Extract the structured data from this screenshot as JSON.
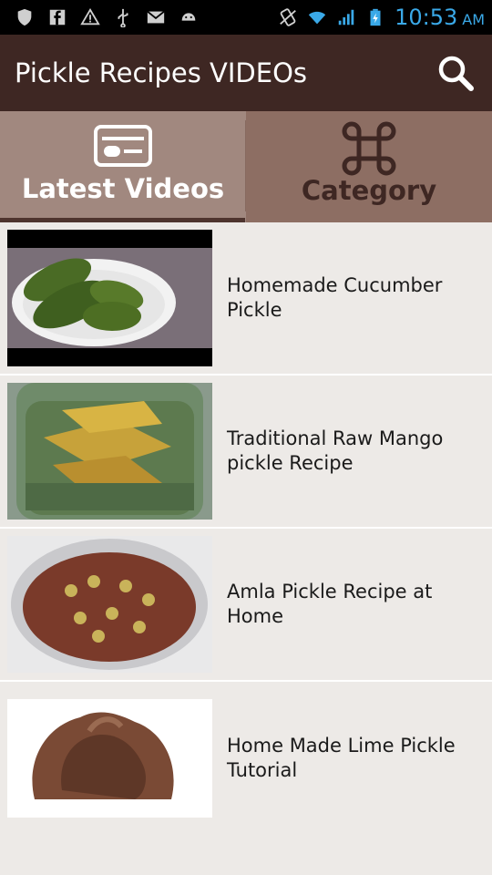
{
  "status_bar": {
    "icons": [
      "shield-icon",
      "facebook-icon",
      "warning-icon",
      "usb-icon",
      "mail-icon",
      "android-icon",
      "vibrate-icon",
      "wifi-icon",
      "signal-icon",
      "battery-icon"
    ],
    "time": "10:53",
    "ampm": "AM"
  },
  "app_bar": {
    "title": "Pickle Recipes VIDEOs",
    "search_icon": "search-icon"
  },
  "tabs": [
    {
      "label": "Latest Videos",
      "icon": "video-card-icon",
      "active": true
    },
    {
      "label": "Category",
      "icon": "command-icon",
      "active": false
    }
  ],
  "videos": [
    {
      "title": "Homemade Cucumber Pickle"
    },
    {
      "title": "Traditional Raw Mango pickle Recipe"
    },
    {
      "title": "Amla Pickle Recipe at Home"
    },
    {
      "title": "Home Made Lime Pickle Tutorial"
    }
  ],
  "colors": {
    "status_bar": "#000000",
    "app_bar": "#3e2723",
    "tab_bar": "#8d6e63",
    "tab_active": "#a1887f",
    "clock": "#3aa9e8",
    "list_bg": "#edeae7"
  }
}
